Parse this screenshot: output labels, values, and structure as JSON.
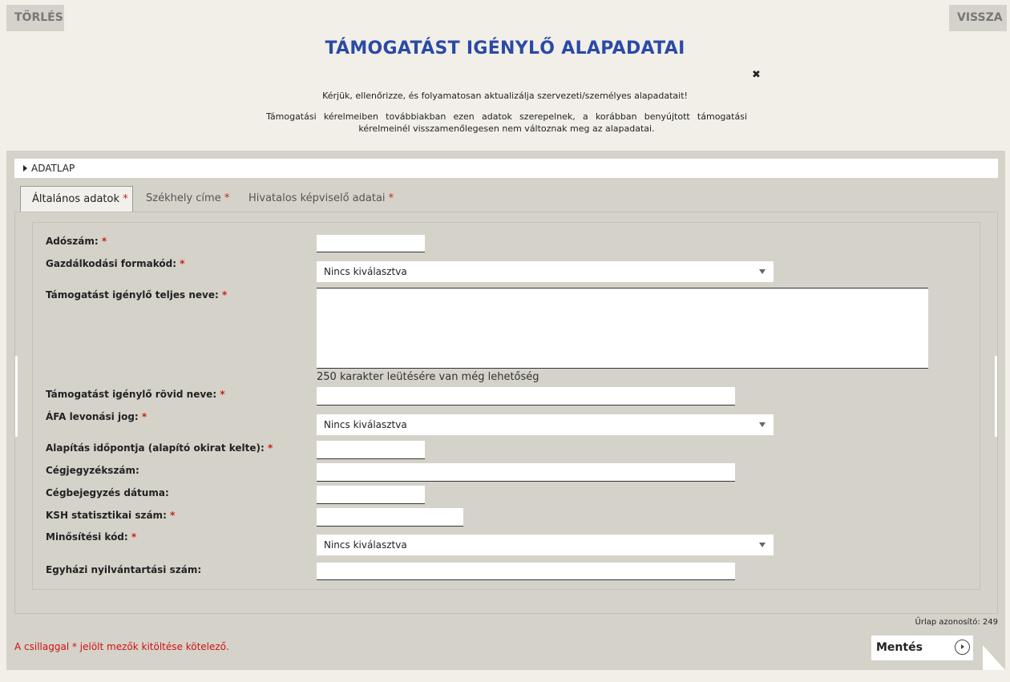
{
  "top": {
    "clear_label": "TÖRLÉS",
    "back_label": "VISSZA"
  },
  "title": "TÁMOGATÁST IGÉNYLŐ ALAPADATAI",
  "close_glyph": "✖",
  "info": {
    "line1": "Kérjük, ellenőrizze, és folyamatosan aktualizálja szervezeti/személyes alapadatait!",
    "line2": "Támogatási kérelmeiben továbbiakban ezen adatok szerepelnek, a korábban benyújtott támogatási kérelmeinél visszamenőlegesen nem változnak meg az alapadatai."
  },
  "section": {
    "label": "ADATLAP"
  },
  "tabs": [
    {
      "label": "Általános adatok",
      "required": "*",
      "active": true
    },
    {
      "label": "Székhely címe",
      "required": "*"
    },
    {
      "label": "Hivatalos képviselő adatai",
      "required": "*"
    }
  ],
  "required_mark": "*",
  "fields": {
    "adoszam": {
      "label": "Adószám:",
      "value": ""
    },
    "gazd_formakod": {
      "label": "Gazdálkodási formakód:",
      "selected": "Nincs kiválasztva"
    },
    "teljes_nev": {
      "label": "Támogatást igénylő teljes neve:",
      "value": "",
      "counter": "250 karakter leütésére van még lehetőség"
    },
    "rovid_nev": {
      "label": "Támogatást igénylő rövid neve:",
      "value": ""
    },
    "afa_jog": {
      "label": "ÁFA levonási jog:",
      "selected": "Nincs kiválasztva"
    },
    "alapitas": {
      "label": "Alapítás időpontja (alapító okirat kelte):",
      "value": ""
    },
    "cegjegyzekszam": {
      "label": "Cégjegyzékszám:",
      "value": ""
    },
    "cegbejegyzes": {
      "label": "Cégbejegyzés dátuma:",
      "value": ""
    },
    "ksh": {
      "label": "KSH statisztikai szám:",
      "value": ""
    },
    "minositesi_kod": {
      "label": "Minősítési kód:",
      "selected": "Nincs kiválasztva"
    },
    "egyhazi": {
      "label": "Egyházi nyilvántartási szám:",
      "value": ""
    }
  },
  "footer": {
    "form_id": "Űrlap azonosító: 249",
    "required_note": "A csillaggal * jelölt mezők kitöltése kötelező.",
    "save_label": "Mentés"
  }
}
